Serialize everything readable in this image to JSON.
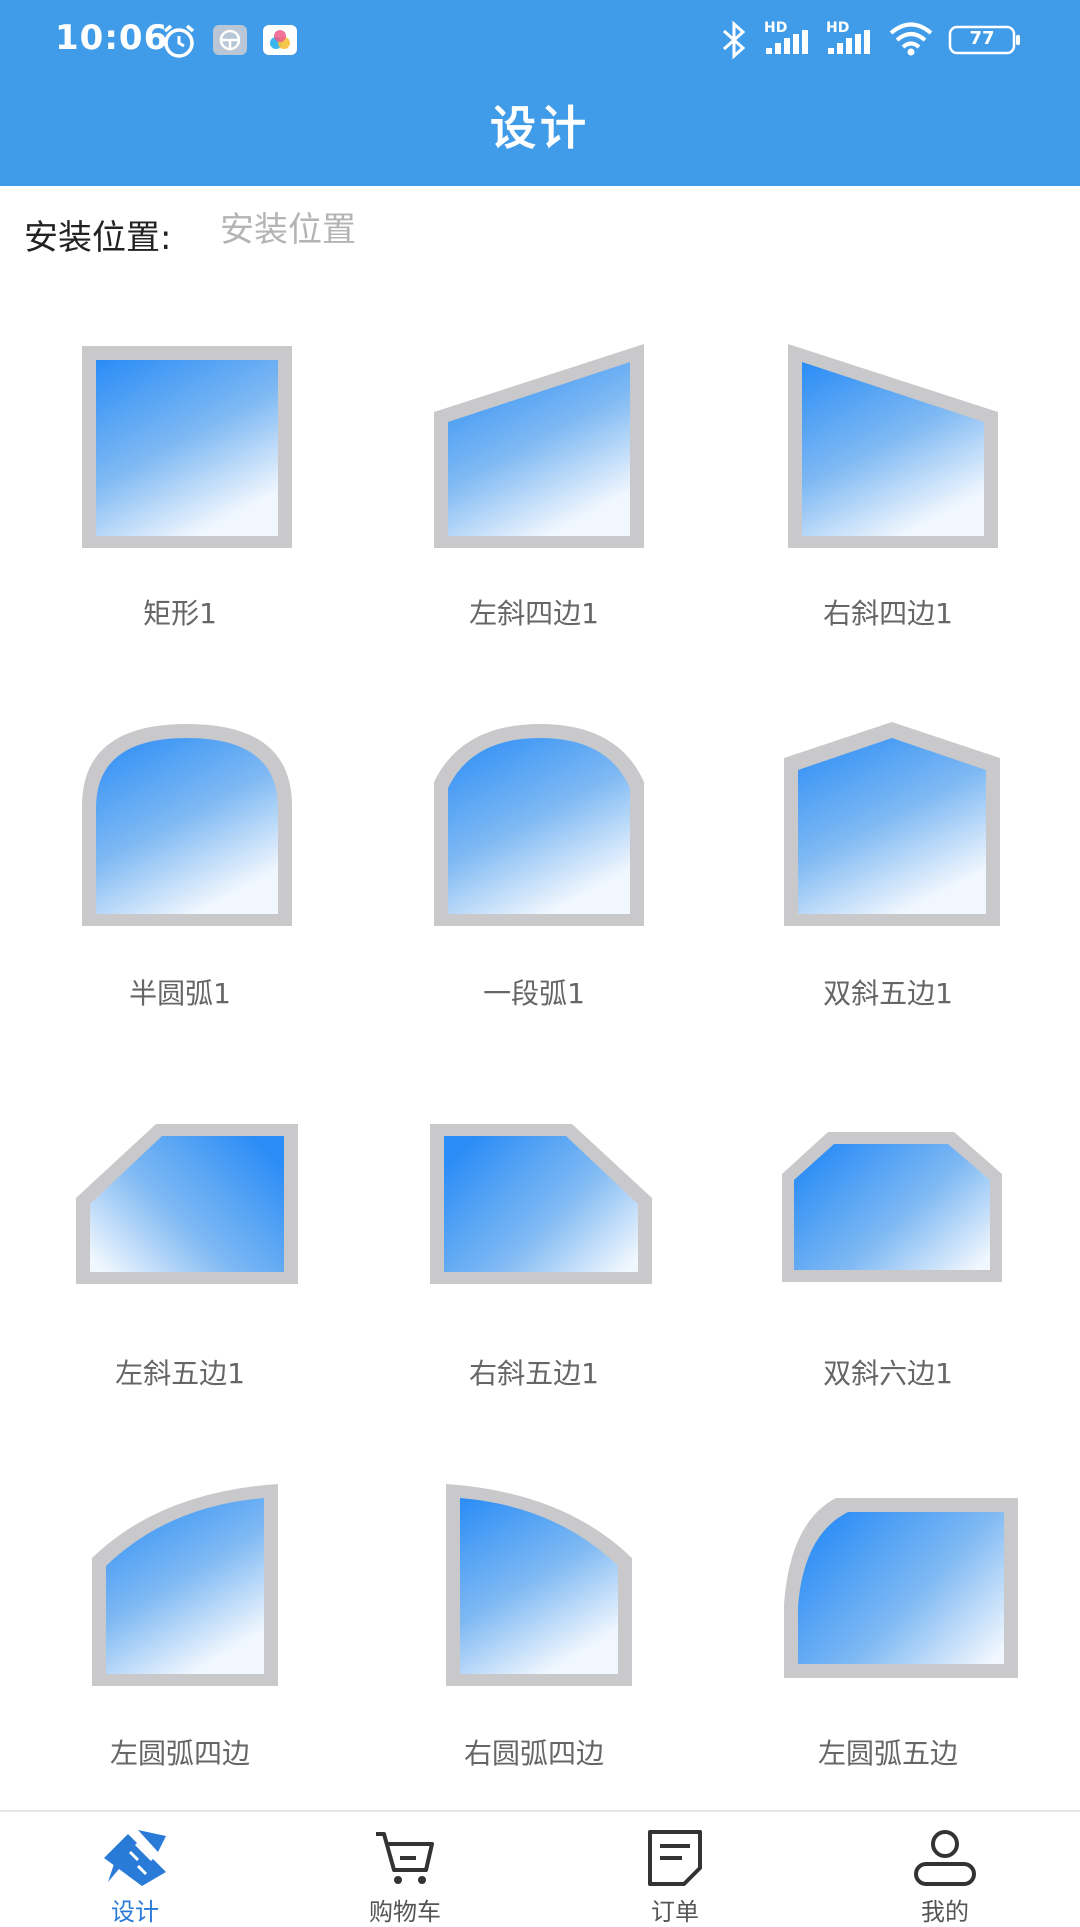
{
  "status_bar": {
    "time": "10:06",
    "battery": "77",
    "network_badge_1": "HD",
    "network_badge_2": "HD"
  },
  "header": {
    "title": "设计"
  },
  "install": {
    "label": "安装位置:",
    "placeholder": "安装位置"
  },
  "shapes": [
    {
      "label": "矩形1",
      "icon": "rectangle-window-icon"
    },
    {
      "label": "左斜四边1",
      "icon": "left-slant-quad-window-icon"
    },
    {
      "label": "右斜四边1",
      "icon": "right-slant-quad-window-icon"
    },
    {
      "label": "半圆弧1",
      "icon": "semicircle-arch-window-icon"
    },
    {
      "label": "一段弧1",
      "icon": "segment-arch-window-icon"
    },
    {
      "label": "双斜五边1",
      "icon": "double-slant-pentagon-window-icon"
    },
    {
      "label": "左斜五边1",
      "icon": "left-slant-pentagon-window-icon"
    },
    {
      "label": "右斜五边1",
      "icon": "right-slant-pentagon-window-icon"
    },
    {
      "label": "双斜六边1",
      "icon": "double-slant-hexagon-window-icon"
    },
    {
      "label": "左圆弧四边",
      "icon": "left-arc-quad-window-icon"
    },
    {
      "label": "右圆弧四边",
      "icon": "right-arc-quad-window-icon"
    },
    {
      "label": "左圆弧五边",
      "icon": "left-arc-pentagon-window-icon"
    }
  ],
  "tabs": [
    {
      "label": "设计",
      "icon": "design-ruler-icon",
      "active": true
    },
    {
      "label": "购物车",
      "icon": "cart-icon",
      "active": false
    },
    {
      "label": "订单",
      "icon": "order-note-icon",
      "active": false
    },
    {
      "label": "我的",
      "icon": "profile-icon",
      "active": false
    }
  ],
  "colors": {
    "header_bg": "#409ce8",
    "frame": "#c9c9cb",
    "glass_top": "#2b8df5",
    "glass_bottom": "#eef5fd",
    "tab_active": "#2a7bd8"
  }
}
